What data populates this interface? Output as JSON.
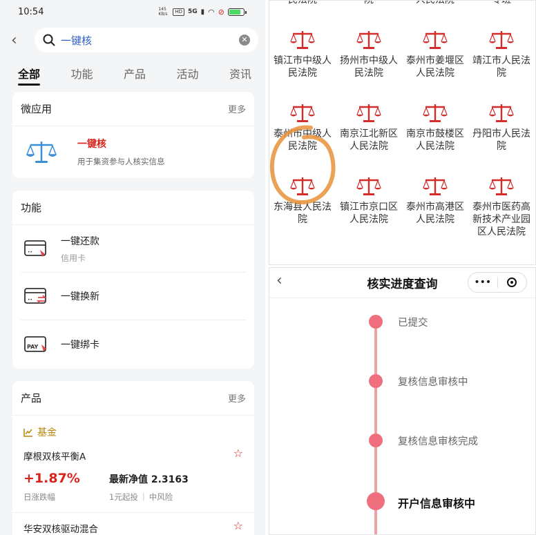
{
  "status_bar": {
    "time": "10:54",
    "speed": "145 KB/s",
    "hd": "HD",
    "net": "5G"
  },
  "search": {
    "value": "一键核",
    "placeholder": ""
  },
  "tabs": [
    {
      "label": "全部",
      "active": true
    },
    {
      "label": "功能"
    },
    {
      "label": "产品"
    },
    {
      "label": "活动"
    },
    {
      "label": "资讯"
    }
  ],
  "mini_apps": {
    "title": "微应用",
    "more": "更多",
    "item": {
      "name": "一键核",
      "desc": "用于集资参与人核实信息",
      "icon": "scale-icon"
    }
  },
  "functions": {
    "title": "功能",
    "items": [
      {
        "name": "一键还款",
        "sub": "信用卡",
        "icon": "card-repay-icon"
      },
      {
        "name": "一键换新",
        "sub": "",
        "icon": "card-renew-icon"
      },
      {
        "name": "一键绑卡",
        "sub": "",
        "icon": "card-pay-icon"
      }
    ]
  },
  "products": {
    "title": "产品",
    "more": "更多",
    "category": "基金",
    "fund": {
      "name": "摩根双核平衡A",
      "daily_change": "+1.87%",
      "daily_change_label": "日涨跌幅",
      "nav": "最新净值 2.3163",
      "min_invest": "1元起投",
      "risk": "中风险"
    },
    "fund2": {
      "name": "华安双核驱动混合"
    }
  },
  "courts": [
    {
      "name": "南京市中级人民法院"
    },
    {
      "name": "仪征市人民法院"
    },
    {
      "name": "南京市建邺区人民法院"
    },
    {
      "name": "盛唐处置工作专班"
    },
    {
      "name": "镇江市中级人民法院"
    },
    {
      "name": "扬州市中级人民法院"
    },
    {
      "name": "泰州市姜堰区人民法院"
    },
    {
      "name": "靖江市人民法院"
    },
    {
      "name": "泰州市中级人民法院"
    },
    {
      "name": "南京江北新区人民法院"
    },
    {
      "name": "南京市鼓楼区人民法院"
    },
    {
      "name": "丹阳市人民法院"
    },
    {
      "name": "东海县人民法院"
    },
    {
      "name": "镇江市京口区人民法院"
    },
    {
      "name": "泰州市高港区人民法院"
    },
    {
      "name": "泰州市医药高新技术产业园区人民法院"
    }
  ],
  "progress": {
    "title": "核实进度查询",
    "capsule_more": "•••",
    "steps": [
      {
        "label": "已提交",
        "state": "done"
      },
      {
        "label": "复核信息审核中",
        "state": "done"
      },
      {
        "label": "复核信息审核完成",
        "state": "done"
      },
      {
        "label": "开户信息审核中",
        "state": "current"
      }
    ]
  },
  "colors": {
    "accent_red": "#d9231b",
    "timeline": "#ef6f7c",
    "link_blue": "#2d61c9",
    "fund_gold": "#b8860b",
    "annotation": "#e8923a"
  }
}
